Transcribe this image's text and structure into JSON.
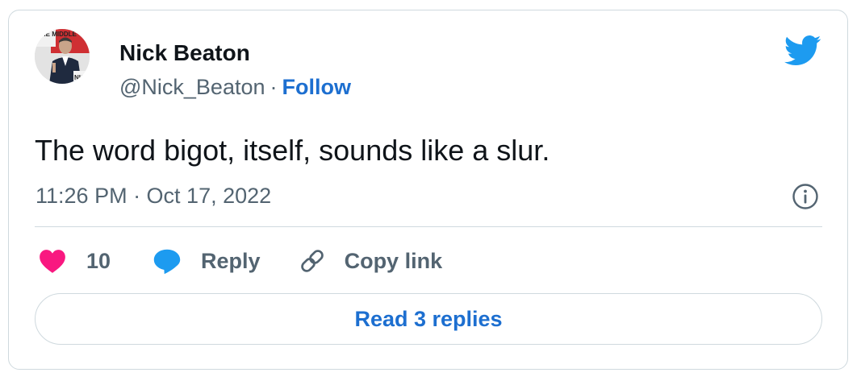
{
  "author": {
    "name": "Nick Beaton",
    "handle": "@Nick_Beaton",
    "separator": "·",
    "follow_label": "Follow",
    "avatar_icon": "profile-photo",
    "avatar_backdrop_text_top": "THE MIDDLE",
    "avatar_backdrop_text_bottom": "NIC"
  },
  "brand": {
    "logo_icon": "twitter-bird-icon",
    "accent_color": "#1d9bf0",
    "link_color": "#1d6fd0"
  },
  "tweet": {
    "text": "The word bigot, itself, sounds like a slur.",
    "timestamp": "11:26 PM · Oct 17, 2022"
  },
  "info_icon": "info-circle-icon",
  "actions": {
    "like": {
      "icon": "heart-icon",
      "count": "10",
      "color": "#f91880"
    },
    "reply": {
      "icon": "speech-bubble-icon",
      "label": "Reply",
      "color": "#1d9bf0"
    },
    "copy_link": {
      "icon": "link-icon",
      "label": "Copy link"
    }
  },
  "read_replies_label": "Read 3 replies"
}
